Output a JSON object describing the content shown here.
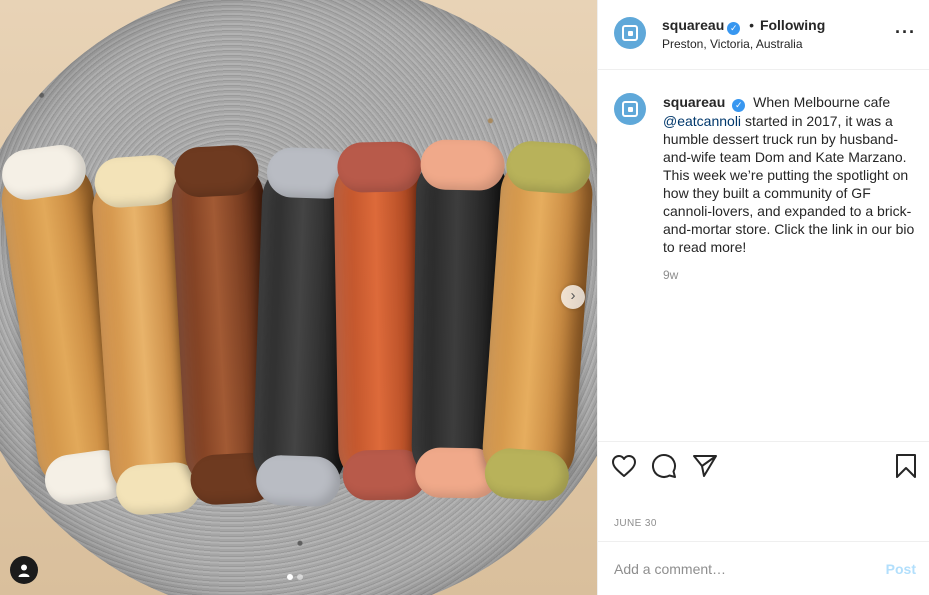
{
  "post": {
    "images": {
      "count": 2,
      "active_index": 0
    }
  },
  "header": {
    "username": "squareau",
    "verified_glyph": "✓",
    "separator": "•",
    "follow_label": "Following",
    "location": "Preston, Victoria, Australia",
    "more_label": "···"
  },
  "caption": {
    "username": "squareau",
    "verified_glyph": "✓",
    "text_before": "When Melbourne cafe",
    "mention": "@eatcannoli",
    "text_after": "started in 2017, it was a humble dessert truck run by husband-and-wife team Dom and Kate Marzano. This week we’re putting the spotlight on how they built a community of GF cannoli-lovers, and expanded to a brick-and-mortar store. Click the link in our bio to read more!",
    "time_ago": "9w"
  },
  "actions": {
    "like_icon": "heart-icon",
    "comment_icon": "comment-icon",
    "share_icon": "paper-plane-icon",
    "save_icon": "bookmark-icon"
  },
  "date": "JUNE 30",
  "comment": {
    "placeholder": "Add a comment…",
    "value": "",
    "post_label": "Post"
  },
  "media": {
    "next_arrow": "›"
  },
  "colors": {
    "accent_blue": "#3897f0",
    "post_disabled": "#b2dffc",
    "avatar_bg": "#5fa8d9"
  }
}
